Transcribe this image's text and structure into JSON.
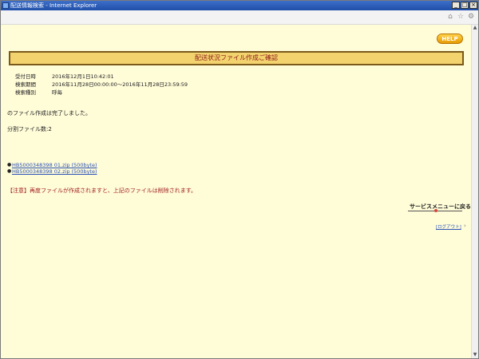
{
  "window": {
    "title": "配送情報検索 - Internet Explorer",
    "controls": {
      "minimize": "_",
      "maximize": "□",
      "close": "×"
    }
  },
  "toolbar": {
    "icons": [
      {
        "name": "home-icon",
        "glyph": "⌂"
      },
      {
        "name": "favorites-star-icon",
        "glyph": "☆"
      },
      {
        "name": "settings-gear-icon",
        "glyph": "⚙"
      }
    ]
  },
  "page": {
    "help_label": "HELP",
    "title": "配送状況ファイル作成ご確認",
    "info": [
      {
        "label": "受付日時",
        "value": "2016年12月1日10:42:01"
      },
      {
        "label": "検索期間",
        "value": "2016年11月28日00:00:00～2016年11月28日23:59:59"
      },
      {
        "label": "検索種別",
        "value": "呼毎"
      }
    ],
    "completion_message": "のファイル作成は完了しました。",
    "file_count": "分割ファイル数:2",
    "files": [
      {
        "bullet": "●",
        "text": "HB5000348398 01.zip (500byte)"
      },
      {
        "bullet": "●",
        "text": "HB5000348398 02.zip (500byte)"
      }
    ],
    "warning": "【注意】再度ファイルが作成されますと、上記のファイルは削除されます。",
    "return_label": "サービスメニューに戻る",
    "logout_label": "[ログアウト]",
    "logout_arrow": "›"
  },
  "scrollbar": {
    "up": "▲",
    "down": "▼"
  }
}
